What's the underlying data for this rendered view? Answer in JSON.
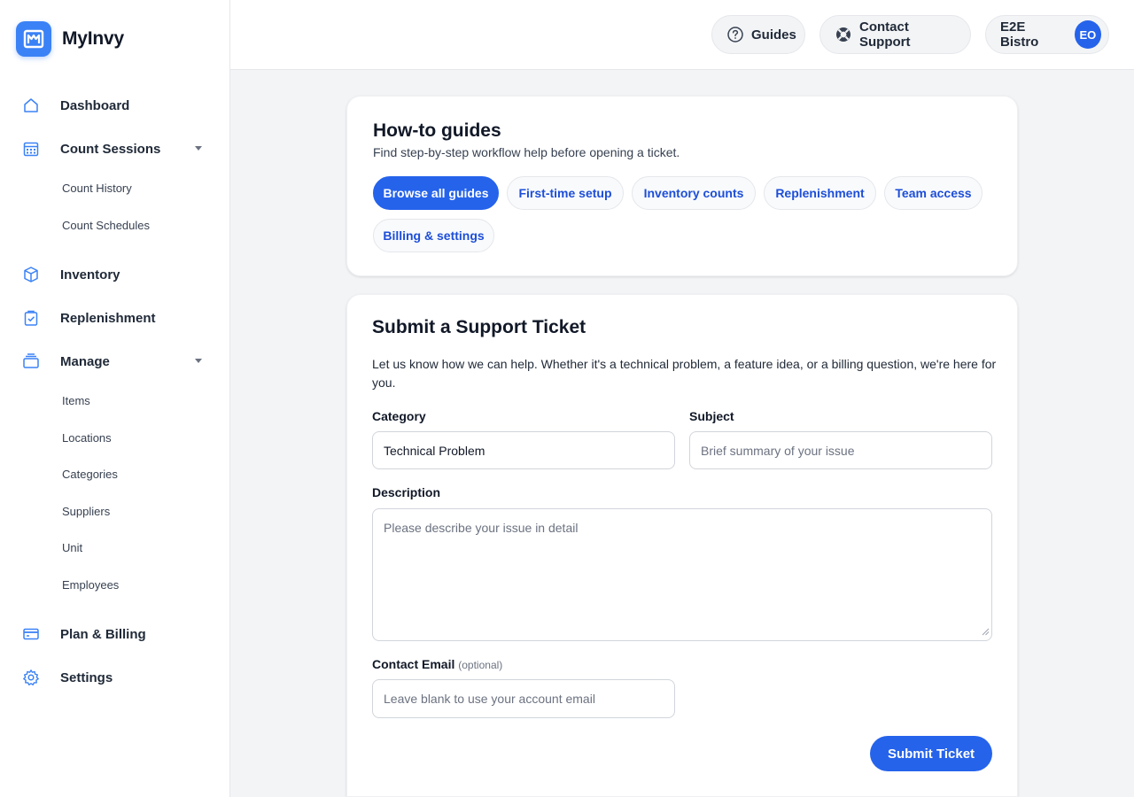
{
  "app": {
    "name": "MyInvy",
    "accent": "#2563eb"
  },
  "sidebar": {
    "items": [
      {
        "label": "Dashboard",
        "icon": "home-icon"
      },
      {
        "label": "Count Sessions",
        "icon": "calendar-icon",
        "expanded": true,
        "children": [
          "Count History",
          "Count Schedules"
        ]
      },
      {
        "label": "Inventory",
        "icon": "box-icon"
      },
      {
        "label": "Replenishment",
        "icon": "clipboard-check-icon"
      },
      {
        "label": "Manage",
        "icon": "layers-icon",
        "expanded": true,
        "children": [
          "Items",
          "Locations",
          "Categories",
          "Suppliers",
          "Unit",
          "Employees"
        ]
      },
      {
        "label": "Plan & Billing",
        "icon": "credit-card-icon"
      },
      {
        "label": "Settings",
        "icon": "gear-icon"
      }
    ]
  },
  "header": {
    "guides_label": "Guides",
    "support_label": "Contact Support",
    "account_name": "E2E Bistro",
    "account_initials": "EO"
  },
  "guides_card": {
    "title": "How-to guides",
    "subtitle": "Find step-by-step workflow help before opening a ticket.",
    "chips": [
      "Browse all guides",
      "First-time setup",
      "Inventory counts",
      "Replenishment",
      "Team access",
      "Billing & settings"
    ],
    "active_chip": "Browse all guides"
  },
  "ticket_form": {
    "title": "Submit a Support Ticket",
    "intro": "Let us know how we can help. Whether it's a technical problem, a feature idea, or a billing question, we're here for you.",
    "category_label": "Category",
    "category_value": "Technical Problem",
    "subject_label": "Subject",
    "subject_placeholder": "Brief summary of your issue",
    "description_label": "Description",
    "description_placeholder": "Please describe your issue in detail",
    "email_label": "Contact Email",
    "email_optional": "(optional)",
    "email_placeholder": "Leave blank to use your account email",
    "submit_label": "Submit Ticket"
  }
}
